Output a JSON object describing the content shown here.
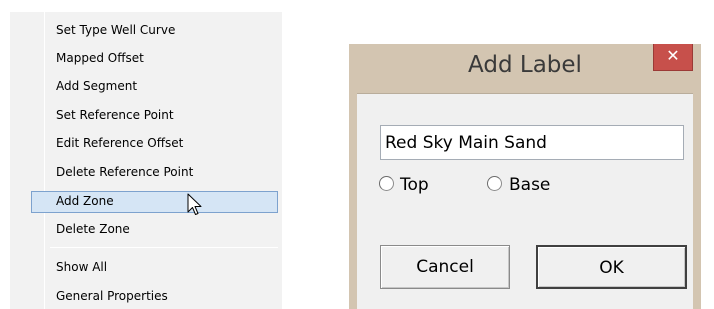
{
  "context_menu": {
    "items": [
      "Set Type Well Curve",
      "Mapped Offset",
      "Add Segment",
      "Set Reference Point",
      "Edit Reference Offset",
      "Delete Reference Point",
      "Add Zone",
      "Delete Zone",
      "Show All",
      "General Properties"
    ],
    "highlighted_item": "Add Zone"
  },
  "dialog": {
    "title": "Add Label",
    "close_glyph": "✕",
    "label_value": "Red Sky Main Sand",
    "radio_options": [
      "Top",
      "Base"
    ],
    "cancel_label": "Cancel",
    "ok_label": "OK"
  },
  "icons": [
    "arrow-cursor-icon",
    "close-icon"
  ]
}
